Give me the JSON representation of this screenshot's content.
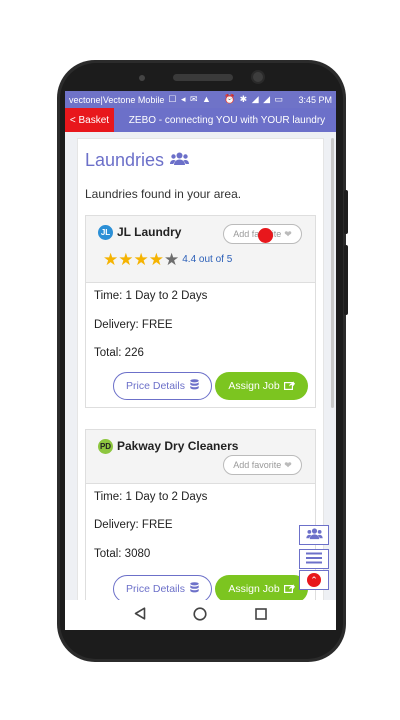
{
  "status_bar": {
    "carrier": "vectone|Vectone Mobile",
    "left_icons": "☐ ◂ ✉ ▲",
    "right_icons": "⏰ ✱ ◢ ◢ ▭",
    "time": "3:45 PM"
  },
  "app_bar": {
    "back_label": "< Basket",
    "title": "ZEBO - connecting YOU with YOUR laundry"
  },
  "page": {
    "heading": "Laundries",
    "subtext": "Laundries found in your area."
  },
  "laundries": [
    {
      "logo_text": "JL",
      "name": "JL Laundry",
      "favorite_label": "Add favorite",
      "rating_text": "4.4 out of 5",
      "rating": 4.4,
      "time_text": "Time: 1 Day to 2 Days",
      "delivery_text": "Delivery: FREE",
      "total_text": "Total: 226",
      "price_details_label": "Price Details",
      "assign_job_label": "Assign Job"
    },
    {
      "logo_text": "PD",
      "name": "Pakway Dry Cleaners",
      "favorite_label": "Add favorite",
      "time_text": "Time: 1 Day to 2 Days",
      "delivery_text": "Delivery: FREE",
      "total_text": "Total: 3080",
      "price_details_label": "Price Details",
      "assign_job_label": "Assign Job"
    }
  ],
  "colors": {
    "brand": "#6c70c9",
    "back_button": "#e8171c",
    "assign_button": "#7cc520",
    "star": "#f5b301",
    "rating_link": "#2b5fb8"
  },
  "icons": {
    "heading_icon": "users-icon",
    "favorite_icon": "heart-icon",
    "price_icon": "database-icon",
    "assign_icon": "share-icon",
    "float_buttons": [
      "users-icon",
      "menu-icon",
      "arrow-up-icon"
    ],
    "nav": [
      "back-triangle-icon",
      "home-circle-icon",
      "recents-square-icon"
    ]
  }
}
